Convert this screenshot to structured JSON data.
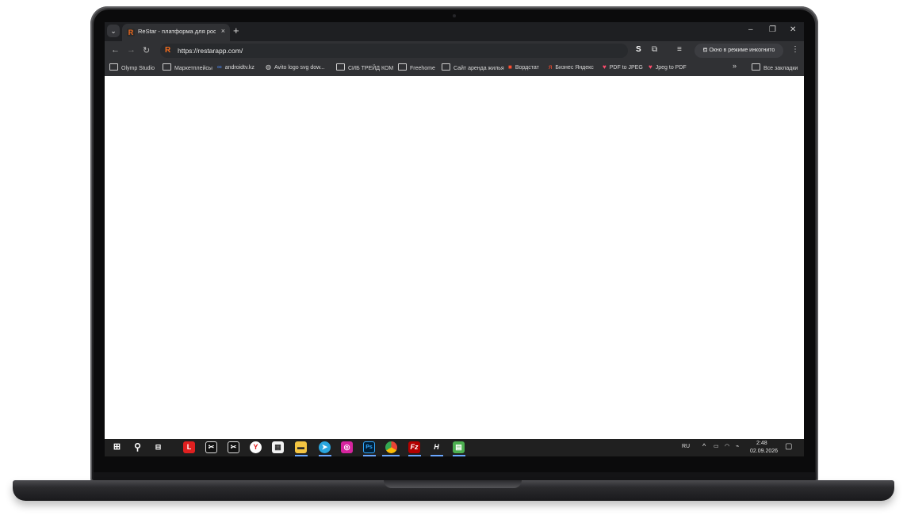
{
  "browser": {
    "tab_title": "ReStar - платформа для роста",
    "tab_close": "×",
    "new_tab": "+",
    "url": "https://restarapp.com/",
    "incognito_label": "Окно в режиме инкогнито",
    "favicon_letter": "R",
    "bookmarks": [
      {
        "label": "Olymp Studio",
        "icon": "folder-icon"
      },
      {
        "label": "Маркетплейсы",
        "icon": "folder-icon"
      },
      {
        "label": "androidtv.kz",
        "icon": "meta-icon"
      },
      {
        "label": "Avito logo svg dow...",
        "icon": "globe-icon"
      },
      {
        "label": "СИБ ТРЕЙД КОМ",
        "icon": "folder-icon"
      },
      {
        "label": "Freehome",
        "icon": "folder-icon"
      },
      {
        "label": "Сайт аренда жилья",
        "icon": "folder-icon"
      },
      {
        "label": "Вордстат",
        "icon": "wordstat-icon"
      },
      {
        "label": "Бизнес Яндекс",
        "icon": "yandex-icon"
      },
      {
        "label": "PDF to JPEG",
        "icon": "heart-icon"
      },
      {
        "label": "Jpeg to PDF",
        "icon": "heart-icon"
      }
    ],
    "bookmarks_overflow": "»",
    "all_bookmarks": "Все закладки"
  },
  "taskbar": {
    "language": "RU",
    "time": "2:48",
    "date": "02.09.2026"
  },
  "colors": {
    "accent_orange": "#f26b1d",
    "chrome_dark": "#303134",
    "taskbar": "#202020"
  }
}
